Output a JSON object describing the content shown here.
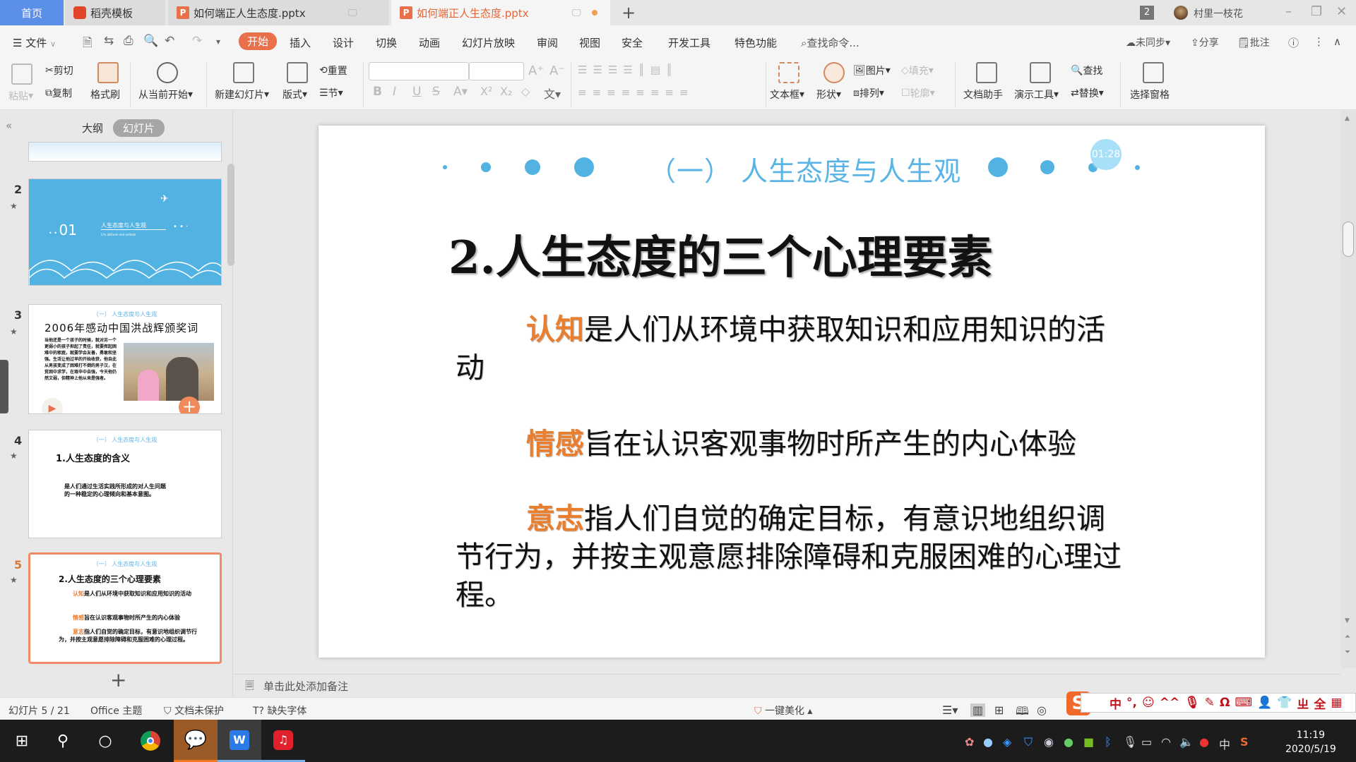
{
  "titlebar": {
    "tabs": [
      {
        "label": "首页"
      },
      {
        "label": "稻壳模板"
      },
      {
        "label": "如何端正人生态度.pptx"
      },
      {
        "label": "如何端正人生态度.pptx",
        "active": true,
        "unsaved": true
      }
    ],
    "window_count": "2",
    "user_name": "村里一枝花"
  },
  "menu": {
    "file": "文件",
    "items": [
      "开始",
      "插入",
      "设计",
      "切换",
      "动画",
      "幻灯片放映",
      "审阅",
      "视图",
      "安全",
      "开发工具",
      "特色功能"
    ],
    "active": "开始",
    "search": "查找命令...",
    "right": {
      "sync": "未同步",
      "share": "分享",
      "comment": "批注"
    }
  },
  "ribbon": {
    "paste": "粘贴",
    "cut": "剪切",
    "copy": "复制",
    "format_painter": "格式刷",
    "play_from_current": "从当前开始",
    "new_slide": "新建幻灯片",
    "layout": "版式",
    "reset": "重置",
    "section": "节",
    "textbox": "文本框",
    "shape": "形状",
    "picture": "图片",
    "fill": "填充",
    "arrange": "排列",
    "outline": "轮廓",
    "doc_assistant": "文档助手",
    "present_tools": "演示工具",
    "find": "查找",
    "replace": "替换",
    "selection_pane": "选择窗格",
    "font_name": "",
    "font_size": ""
  },
  "left_panel": {
    "tab_outline": "大纲",
    "tab_slides": "幻灯片",
    "thumbnails": [
      {
        "num": "2",
        "title": "01",
        "subtitle": "人生态度与人生观",
        "eng": "Life attitude and outlook"
      },
      {
        "num": "3",
        "header": "（一） 人生态度与人生观",
        "title": "2006年感动中国洪战辉颁奖词",
        "body": "当他还是一个孩子的时候，就对另一个更弱小的孩子担起了责任，就要挥起困难中的家庭，就要学会友善，勇敢和坚强。生活让他过早的开始收获，他自此从男孩变成了困难打不倒的男子汉，在贫困中求学，在艰辛中自强，今天他仍然文弱，但精神上他从来是强者。"
      },
      {
        "num": "4",
        "header": "（一） 人生态度与人生观",
        "title": "1.人生态度的含义",
        "body": "是人们通过生活实践所形成的对人生问题的一种稳定的心理倾向和基本意图。"
      },
      {
        "num": "5",
        "header": "（一） 人生态度与人生观",
        "title": "2.人生态度的三个心理要素",
        "selected": true
      }
    ]
  },
  "slide": {
    "subtitle": "（一） 人生态度与人生观",
    "title": "2.人生态度的三个心理要素",
    "paragraphs": [
      {
        "keyword": "认知",
        "text": "是人们从环境中获取知识和应用知识的活动"
      },
      {
        "keyword": "情感",
        "text": "旨在认识客观事物时所产生的内心体验"
      },
      {
        "keyword": "意志",
        "text": "指人们自觉的确定目标，有意识地组织调节行为，并按主观意愿排除障碍和克服困难的心理过程。"
      }
    ],
    "timer": "01:28",
    "accent": "#52b3e3",
    "keyword_color": "#e97e2f"
  },
  "notes": {
    "placeholder": "单击此处添加备注"
  },
  "status": {
    "slide_info": "幻灯片 5 / 21",
    "theme": "Office 主题",
    "protection": "文档未保护",
    "missing_font": "缺失字体",
    "beautify": "一键美化"
  },
  "ime": {
    "mode": "中"
  },
  "taskbar": {
    "time": "11:19",
    "date": "2020/5/19",
    "ime_lang": "中"
  }
}
